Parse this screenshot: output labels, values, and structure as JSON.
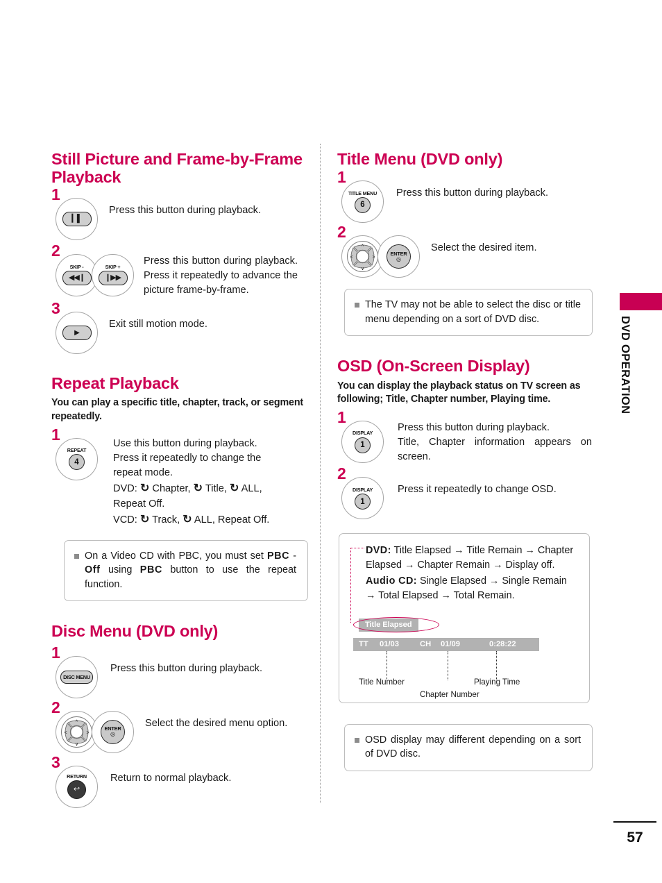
{
  "page": {
    "number": "57",
    "side_tab": "DVD OPERATION",
    "accent_color": "#cc0052",
    "tab_color": "#c80053"
  },
  "left_column": {
    "section1": {
      "heading": "Still Picture and Frame-by-Frame Playback",
      "steps": [
        {
          "num": "1",
          "buttons": [
            {
              "kind": "pill-glyph",
              "glyph": "▐▌",
              "caption": ""
            }
          ],
          "lines": [
            "Press this button during playback."
          ]
        },
        {
          "num": "2",
          "buttons": [
            {
              "kind": "pill-glyph",
              "glyph": "◀◀❙",
              "caption": "SKIP -"
            },
            {
              "kind": "pill-glyph",
              "glyph": "❙▶▶",
              "caption": "SKIP +"
            }
          ],
          "lines": [
            "Press this button during playback. Press it repeatedly to advance the picture frame-by-frame."
          ]
        },
        {
          "num": "3",
          "buttons": [
            {
              "kind": "pill-glyph",
              "glyph": "▶",
              "caption": ""
            }
          ],
          "lines": [
            "Exit still motion mode."
          ]
        }
      ]
    },
    "section2": {
      "heading": "Repeat Playback",
      "intro": "You can play a specific title, chapter, track, or segment repeatedly.",
      "step": {
        "num": "1",
        "button": {
          "caption": "REPEAT",
          "number": "4"
        },
        "line1": "Use this button during playback.",
        "line2": "Press it repeatedly to change the repeat mode.",
        "dvd_prefix": "DVD:",
        "dvd_items": [
          "Chapter,",
          "Title,",
          "ALL,"
        ],
        "dvd_tail": "Repeat Off.",
        "vcd_prefix": "VCD:",
        "vcd_items": [
          "Track,",
          "ALL, Repeat Off."
        ],
        "loop_icon": "⟳"
      },
      "note": {
        "text_a": "On a Video CD with PBC, you must set ",
        "bold_a": "PBC",
        "text_b": " - ",
        "bold_b": "Off",
        "text_c": " using ",
        "bold_c": "PBC",
        "text_d": " button to use the repeat function."
      }
    },
    "section3": {
      "heading": "Disc Menu (DVD only)",
      "steps": [
        {
          "num": "1",
          "button_label": "DISC MENU",
          "text": "Press this button during playback."
        },
        {
          "num": "2",
          "enter_label": "ENTER",
          "text": "Select the desired menu option."
        },
        {
          "num": "3",
          "button_caption": "RETURN",
          "button_glyph": "↩",
          "text": "Return to normal playback."
        }
      ]
    }
  },
  "right_column": {
    "section1": {
      "heading": "Title Menu (DVD only)",
      "steps": [
        {
          "num": "1",
          "caption": "TITLE MENU",
          "number": "6",
          "text": "Press this button during playback."
        },
        {
          "num": "2",
          "enter_label": "ENTER",
          "text": "Select the desired item."
        }
      ],
      "note": "The TV may not be able to select the disc or title menu depending on a sort of DVD disc."
    },
    "section2": {
      "heading": "OSD (On-Screen Display)",
      "intro": "You can display the playback status on TV screen as following; Title, Chapter number, Playing time.",
      "steps": [
        {
          "num": "1",
          "caption": "DISPLAY",
          "number": "1",
          "lines": [
            "Press this button during playback.",
            "Title, Chapter information appears on screen."
          ]
        },
        {
          "num": "2",
          "caption": "DISPLAY",
          "number": "1",
          "lines": [
            "Press it repeatedly to change OSD."
          ]
        }
      ],
      "osd_diagram": {
        "dvd_label": "DVD:",
        "dvd_sequence": "Title Elapsed → Title Remain → Chapter Elapsed → Chapter Remain → Display off.",
        "cd_label": "Audio CD:",
        "cd_sequence": "Single Elapsed → Single Remain → Total Elapsed → Total Remain.",
        "tag": "Title Elapsed",
        "bar": {
          "title_key": "TT",
          "title_value": "01/03",
          "chapter_key": "CH",
          "chapter_value": "01/09",
          "time_value": "0:28:22"
        },
        "captions": {
          "title_number": "Title Number",
          "chapter_number": "Chapter Number",
          "playing_time": "Playing Time"
        }
      },
      "note": "OSD display may different depending on a sort of DVD disc."
    }
  }
}
